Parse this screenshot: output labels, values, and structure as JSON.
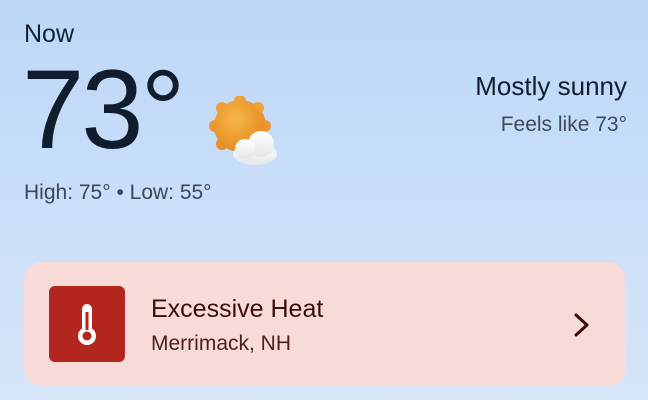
{
  "current": {
    "label": "Now",
    "temperature": "73°",
    "high_low": "High: 75° • Low: 55°",
    "condition": "Mostly sunny",
    "feels_like": "Feels like 73°",
    "icon": "sun-behind-cloud-icon"
  },
  "alert": {
    "title": "Excessive Heat",
    "location": "Merrimack, NH",
    "icon": "thermometer-icon",
    "action_icon": "chevron-right-icon",
    "colors": {
      "card_background": "#f8dad8",
      "icon_background": "#b3261e"
    }
  },
  "colors": {
    "background_top": "#bcd7f7",
    "background_bottom": "#d6e5f8",
    "text_primary": "#0f1d2e"
  }
}
